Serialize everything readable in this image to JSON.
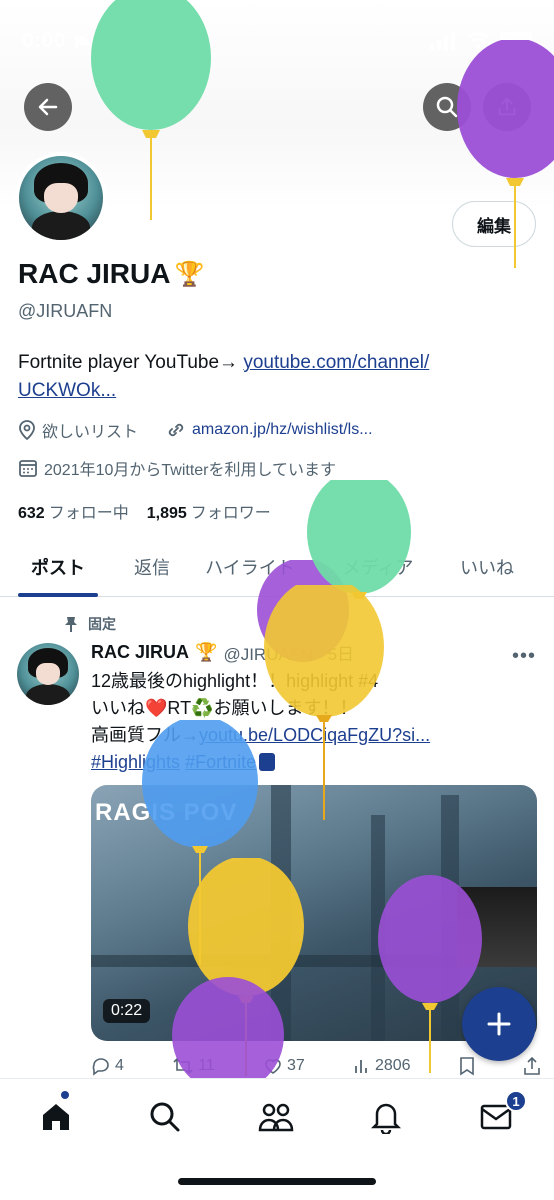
{
  "status_bar": {
    "time": "0:00",
    "battery": "51"
  },
  "profile": {
    "edit_label": "編集",
    "name": "RAC JIRUA",
    "name_emoji": "🏆",
    "handle": "@JIRUAFN",
    "bio_text": "Fortnite player YouTube→ ",
    "bio_link_1": "youtube.com/channel/",
    "bio_link_2": "UCKWOk...",
    "wishlist_label": "欲しいリスト",
    "wishlist_link": "amazon.jp/hz/wishlist/ls...",
    "joined": "2021年10月からTwitterを利用しています",
    "following_count": "632",
    "following_label": "フォロー中",
    "followers_count": "1,895",
    "followers_label": "フォロワー"
  },
  "tabs": [
    "ポスト",
    "返信",
    "ハイライト",
    "メディア",
    "いいね"
  ],
  "post": {
    "pinned_label": "固定",
    "author": "RAC JIRUA",
    "author_emoji": "🏆",
    "handle_time": "@JIRUAFN · 5日",
    "line1": "12歳最後のhighlight！！highlight #4",
    "line2": "いいね❤️RT♻️お願いします！！",
    "line3_text": "高画質フル→",
    "line3_link": "youtu.be/LODCiqaFgZU?si...",
    "hashtag1": "#Highlights",
    "hashtag2": "#Fortnite",
    "media_title": "RAGIS POV",
    "duration": "0:22",
    "replies": "4",
    "reposts": "11",
    "likes": "37",
    "views": "2806"
  },
  "nav": {
    "messages_badge": "1"
  },
  "colors": {
    "accent": "#1d3f8f",
    "green_balloon": "#6fdba8",
    "purple_balloon": "#9b4fd6",
    "yellow_balloon": "#f2c832",
    "blue_balloon": "#4f9cf0"
  }
}
